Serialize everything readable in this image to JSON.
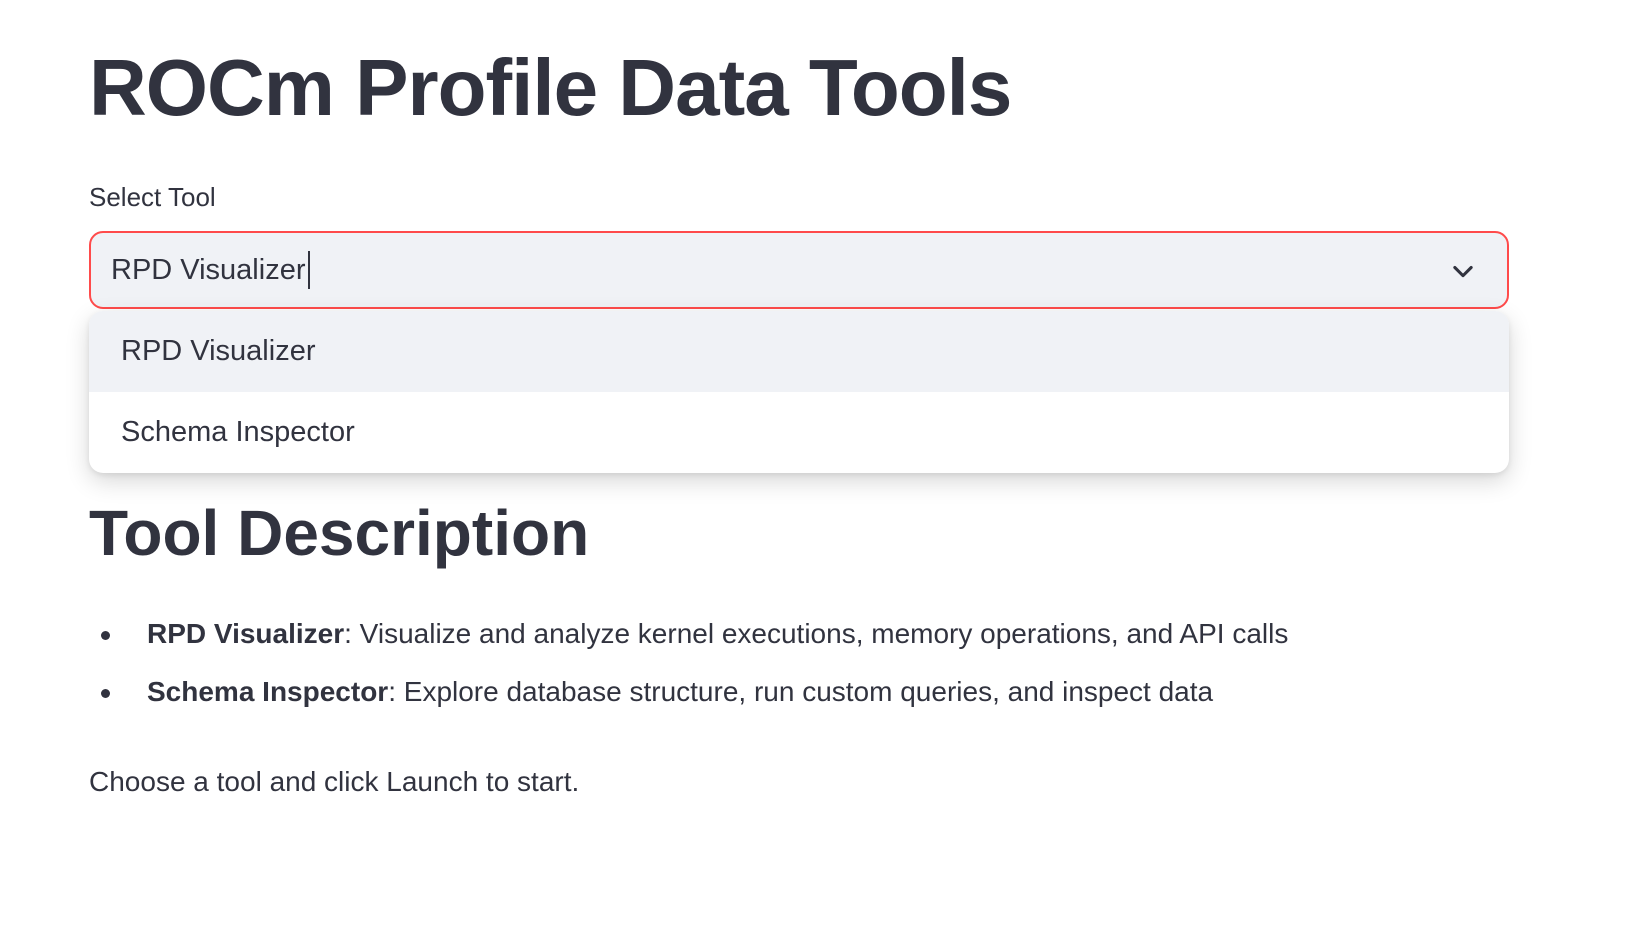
{
  "page": {
    "title": "ROCm Profile Data Tools"
  },
  "tool_select": {
    "label": "Select Tool",
    "value": "RPD Visualizer",
    "icon": "chevron-down-icon",
    "accent_color": "#ff4b4b",
    "options": [
      {
        "label": "RPD Visualizer",
        "highlighted": true
      },
      {
        "label": "Schema Inspector",
        "highlighted": false
      }
    ]
  },
  "description": {
    "heading": "Tool Description",
    "items": [
      {
        "name": "RPD Visualizer",
        "text": ": Visualize and analyze kernel executions, memory operations, and API calls"
      },
      {
        "name": "Schema Inspector",
        "text": ": Explore database structure, run custom queries, and inspect data"
      }
    ],
    "footer": "Choose a tool and click Launch to start."
  }
}
